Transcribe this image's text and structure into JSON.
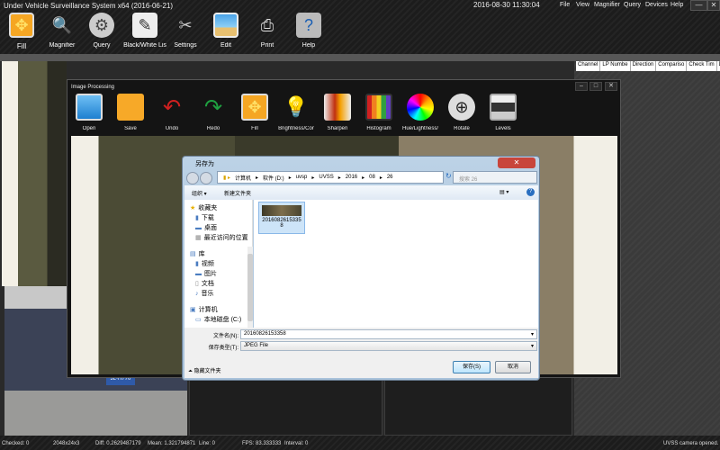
{
  "app": {
    "title": "Under Vehicle Surveillance System x64 (2016-06-21)",
    "clock": "2016-08-30 11:30:04",
    "menu": [
      "File",
      "View",
      "Magnifier",
      "Query",
      "Devices",
      "Help"
    ],
    "window_buttons": {
      "minimize": "—",
      "close": "✕"
    }
  },
  "toolbar": [
    {
      "label": "Fill",
      "icon": "fill-icon"
    },
    {
      "label": "Magnifier",
      "icon": "magnifier-icon"
    },
    {
      "label": "Query",
      "icon": "film-reel-icon"
    },
    {
      "label": "Black/White Lis",
      "icon": "notepad-icon"
    },
    {
      "label": "Settings",
      "icon": "tools-icon"
    },
    {
      "label": "Edit",
      "icon": "picture-icon"
    },
    {
      "label": "Print",
      "icon": "printer-icon"
    },
    {
      "label": "Help",
      "icon": "database-help-icon"
    }
  ],
  "table": {
    "columns": [
      "Channel",
      "LP Numbe",
      "Direction",
      "Compariso",
      "Check Tim",
      "D"
    ]
  },
  "plate_text": "JL·H770",
  "status": {
    "checked": "Checked: 0",
    "resolution": "2048x24x3",
    "diff": "Diff: 0.2629487179",
    "mean": "Mean: 1.321794871",
    "line": "Line: 0",
    "fps": "FPS: 83.333333",
    "interval": "Interval: 0",
    "message": "UVSS camera opened."
  },
  "image_processing": {
    "title": "Image Processing",
    "window_buttons": [
      "–",
      "□",
      "✕"
    ],
    "tools": [
      {
        "label": "Open",
        "icon": "monitor-icon"
      },
      {
        "label": "Save",
        "icon": "folder-icon"
      },
      {
        "label": "Undo",
        "icon": "undo-icon"
      },
      {
        "label": "Redo",
        "icon": "redo-icon"
      },
      {
        "label": "Fill",
        "icon": "fill-icon"
      },
      {
        "label": "Brightness/Cor",
        "icon": "lightbulb-icon"
      },
      {
        "label": "Sharpen",
        "icon": "sharpen-icon"
      },
      {
        "label": "Histogram",
        "icon": "histogram-icon"
      },
      {
        "label": "Hue/Lightness/",
        "icon": "color-wheel-icon"
      },
      {
        "label": "Rotate",
        "icon": "rotate-icon"
      },
      {
        "label": "Levels",
        "icon": "levels-icon"
      }
    ]
  },
  "save_dialog": {
    "title": "另存为",
    "path": [
      "计算机",
      "软件 (D:)",
      "uvsp",
      "UVSS",
      "2016",
      "08",
      "26"
    ],
    "search_placeholder": "搜索 26",
    "organize": "组织 ▾",
    "new_folder": "新建文件夹",
    "nav": {
      "favorites": "收藏夹",
      "favorites_items": [
        "下载",
        "桌面",
        "最近访问的位置"
      ],
      "libraries": "库",
      "library_items": [
        "视频",
        "图片",
        "文档",
        "音乐"
      ],
      "computer": "计算机",
      "computer_items": [
        "本地磁盘 (C:)"
      ]
    },
    "file": {
      "name_line1": "2016082615335",
      "name_line2": "8"
    },
    "filename_label": "文件名(N):",
    "filename_value": "20160826153358",
    "filetype_label": "保存类型(T):",
    "filetype_value": "JPEG File",
    "hide_folders": "隐藏文件夹",
    "save_button": "保存(S)",
    "cancel_button": "取消"
  },
  "colors": {
    "accent": "#f5a623",
    "dialog_frame": "#bcd2e6",
    "close_red": "#c8453b",
    "selection": "#cde4f8"
  }
}
